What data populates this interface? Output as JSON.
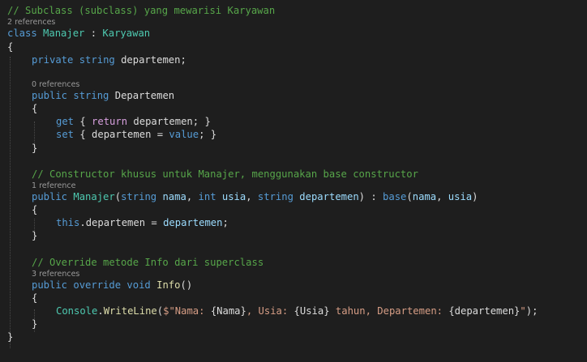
{
  "editor": {
    "colors": {
      "background": "#1e1e1e",
      "comment": "#57a64a",
      "keyword": "#569cd6",
      "control_keyword": "#d8a0df",
      "type": "#4ec9b0",
      "method": "#dcdcaa",
      "string": "#d69d85",
      "identifier": "#dcdcdc",
      "parameter": "#9cdcfe",
      "codelens": "#999999"
    },
    "lines": [
      {
        "kind": "code",
        "indent": 0,
        "tokens": [
          {
            "t": "// Subclass (subclass) yang mewarisi Karyawan",
            "c": "comment"
          }
        ]
      },
      {
        "kind": "lens",
        "indent": 0,
        "text": "2 references"
      },
      {
        "kind": "code",
        "indent": 0,
        "tokens": [
          {
            "t": "class",
            "c": "kw"
          },
          {
            "t": " ",
            "c": "id"
          },
          {
            "t": "Manajer",
            "c": "type"
          },
          {
            "t": " : ",
            "c": "id"
          },
          {
            "t": "Karyawan",
            "c": "type"
          }
        ]
      },
      {
        "kind": "code",
        "indent": 0,
        "tokens": [
          {
            "t": "{",
            "c": "punct"
          }
        ]
      },
      {
        "kind": "code",
        "indent": 1,
        "tokens": [
          {
            "t": "private",
            "c": "kw"
          },
          {
            "t": " ",
            "c": "id"
          },
          {
            "t": "string",
            "c": "kw"
          },
          {
            "t": " departemen;",
            "c": "id"
          }
        ]
      },
      {
        "kind": "blank"
      },
      {
        "kind": "lens",
        "indent": 1,
        "text": "0 references"
      },
      {
        "kind": "code",
        "indent": 1,
        "tokens": [
          {
            "t": "public",
            "c": "kw"
          },
          {
            "t": " ",
            "c": "id"
          },
          {
            "t": "string",
            "c": "kw"
          },
          {
            "t": " Departemen",
            "c": "id"
          }
        ]
      },
      {
        "kind": "code",
        "indent": 1,
        "tokens": [
          {
            "t": "{",
            "c": "punct"
          }
        ]
      },
      {
        "kind": "code",
        "indent": 2,
        "tokens": [
          {
            "t": "get",
            "c": "kw"
          },
          {
            "t": " { ",
            "c": "id"
          },
          {
            "t": "return",
            "c": "ctrl"
          },
          {
            "t": " departemen; }",
            "c": "id"
          }
        ]
      },
      {
        "kind": "code",
        "indent": 2,
        "tokens": [
          {
            "t": "set",
            "c": "kw"
          },
          {
            "t": " { departemen = ",
            "c": "id"
          },
          {
            "t": "value",
            "c": "kw"
          },
          {
            "t": "; }",
            "c": "id"
          }
        ]
      },
      {
        "kind": "code",
        "indent": 1,
        "tokens": [
          {
            "t": "}",
            "c": "punct"
          }
        ]
      },
      {
        "kind": "blank"
      },
      {
        "kind": "code",
        "indent": 1,
        "tokens": [
          {
            "t": "// Constructor khusus untuk Manajer, menggunakan base constructor",
            "c": "comment"
          }
        ]
      },
      {
        "kind": "lens",
        "indent": 1,
        "text": "1 reference"
      },
      {
        "kind": "code",
        "indent": 1,
        "tokens": [
          {
            "t": "public",
            "c": "kw"
          },
          {
            "t": " ",
            "c": "id"
          },
          {
            "t": "Manajer",
            "c": "type"
          },
          {
            "t": "(",
            "c": "id"
          },
          {
            "t": "string",
            "c": "kw"
          },
          {
            "t": " ",
            "c": "id"
          },
          {
            "t": "nama",
            "c": "param"
          },
          {
            "t": ", ",
            "c": "id"
          },
          {
            "t": "int",
            "c": "kw"
          },
          {
            "t": " ",
            "c": "id"
          },
          {
            "t": "usia",
            "c": "param"
          },
          {
            "t": ", ",
            "c": "id"
          },
          {
            "t": "string",
            "c": "kw"
          },
          {
            "t": " ",
            "c": "id"
          },
          {
            "t": "departemen",
            "c": "param"
          },
          {
            "t": ") : ",
            "c": "id"
          },
          {
            "t": "base",
            "c": "kw"
          },
          {
            "t": "(",
            "c": "id"
          },
          {
            "t": "nama",
            "c": "param"
          },
          {
            "t": ", ",
            "c": "id"
          },
          {
            "t": "usia",
            "c": "param"
          },
          {
            "t": ")",
            "c": "id"
          }
        ]
      },
      {
        "kind": "code",
        "indent": 1,
        "tokens": [
          {
            "t": "{",
            "c": "punct"
          }
        ]
      },
      {
        "kind": "code",
        "indent": 2,
        "tokens": [
          {
            "t": "this",
            "c": "kw"
          },
          {
            "t": ".departemen = ",
            "c": "id"
          },
          {
            "t": "departemen",
            "c": "param"
          },
          {
            "t": ";",
            "c": "id"
          }
        ]
      },
      {
        "kind": "code",
        "indent": 1,
        "tokens": [
          {
            "t": "}",
            "c": "punct"
          }
        ]
      },
      {
        "kind": "blank"
      },
      {
        "kind": "code",
        "indent": 1,
        "tokens": [
          {
            "t": "// Override metode Info dari superclass",
            "c": "comment"
          }
        ]
      },
      {
        "kind": "lens",
        "indent": 1,
        "text": "3 references"
      },
      {
        "kind": "code",
        "indent": 1,
        "tokens": [
          {
            "t": "public",
            "c": "kw"
          },
          {
            "t": " ",
            "c": "id"
          },
          {
            "t": "override",
            "c": "kw"
          },
          {
            "t": " ",
            "c": "id"
          },
          {
            "t": "void",
            "c": "kw"
          },
          {
            "t": " ",
            "c": "id"
          },
          {
            "t": "Info",
            "c": "fn"
          },
          {
            "t": "()",
            "c": "id"
          }
        ]
      },
      {
        "kind": "code",
        "indent": 1,
        "tokens": [
          {
            "t": "{",
            "c": "punct"
          }
        ]
      },
      {
        "kind": "code",
        "indent": 2,
        "tokens": [
          {
            "t": "Console",
            "c": "type"
          },
          {
            "t": ".",
            "c": "id"
          },
          {
            "t": "WriteLine",
            "c": "fn"
          },
          {
            "t": "(",
            "c": "id"
          },
          {
            "t": "$\"Nama: ",
            "c": "str"
          },
          {
            "t": "{Nama}",
            "c": "id"
          },
          {
            "t": ", Usia: ",
            "c": "str"
          },
          {
            "t": "{Usia}",
            "c": "id"
          },
          {
            "t": " tahun, Departemen: ",
            "c": "str"
          },
          {
            "t": "{departemen}",
            "c": "id"
          },
          {
            "t": "\"",
            "c": "str"
          },
          {
            "t": ");",
            "c": "id"
          }
        ]
      },
      {
        "kind": "code",
        "indent": 1,
        "tokens": [
          {
            "t": "}",
            "c": "punct"
          }
        ]
      },
      {
        "kind": "code",
        "indent": 0,
        "tokens": [
          {
            "t": "}",
            "c": "punct"
          }
        ]
      }
    ]
  }
}
